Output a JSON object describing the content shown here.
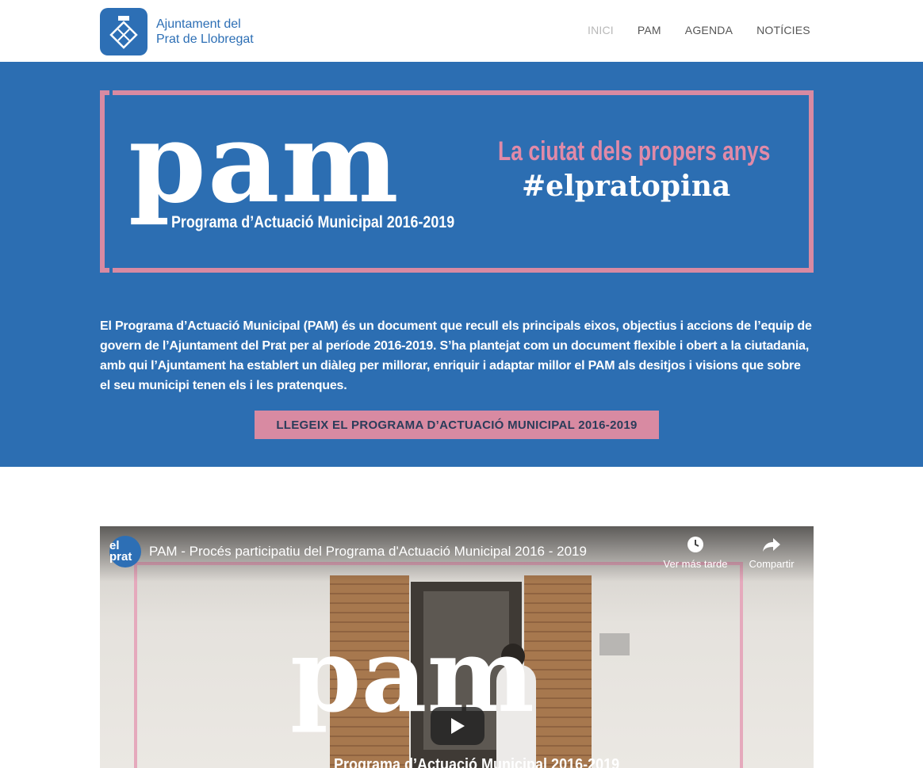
{
  "header": {
    "logo_line1": "Ajuntament del",
    "logo_line2": "Prat de Llobregat",
    "nav": [
      "INICI",
      "PAM",
      "AGENDA",
      "NOTÍCIES"
    ]
  },
  "hero": {
    "banner": {
      "pam_word": "pam",
      "pam_subtitle": "Programa d’Actuació Municipal 2016-2019",
      "tagline": "La ciutat dels propers anys",
      "hashtag": "#elpratopina"
    },
    "intro_text": "El Programa d’Actuació Municipal (PAM) és un  document que recull els principals eixos, objectius i accions de l’equip de govern de l’Ajuntament del Prat per al període 2016-2019. S’ha plantejat com un document flexible i obert a la  ciutadania, amb qui l’Ajuntament ha establert un diàleg per millorar, enriquir i adaptar millor el PAM als desitjos i visions que sobre el seu municipi tenen els i les pratenques.",
    "cta_label": "LLEGEIX EL PROGRAMA D’ACTUACIÓ MUNICIPAL 2016-2019"
  },
  "video": {
    "channel_label": "el prat",
    "title": "PAM - Procés participatiu del Programa d'Actuació Municipal 2016 - 2019",
    "watch_later": "Ver más tarde",
    "share": "Compartir",
    "overlay_word": "pam",
    "overlay_subtitle": "Programa d’Actuació Municipal 2016-2019"
  },
  "colors": {
    "brand_blue": "#2c6eb2",
    "accent_pink": "#d88aa2"
  }
}
